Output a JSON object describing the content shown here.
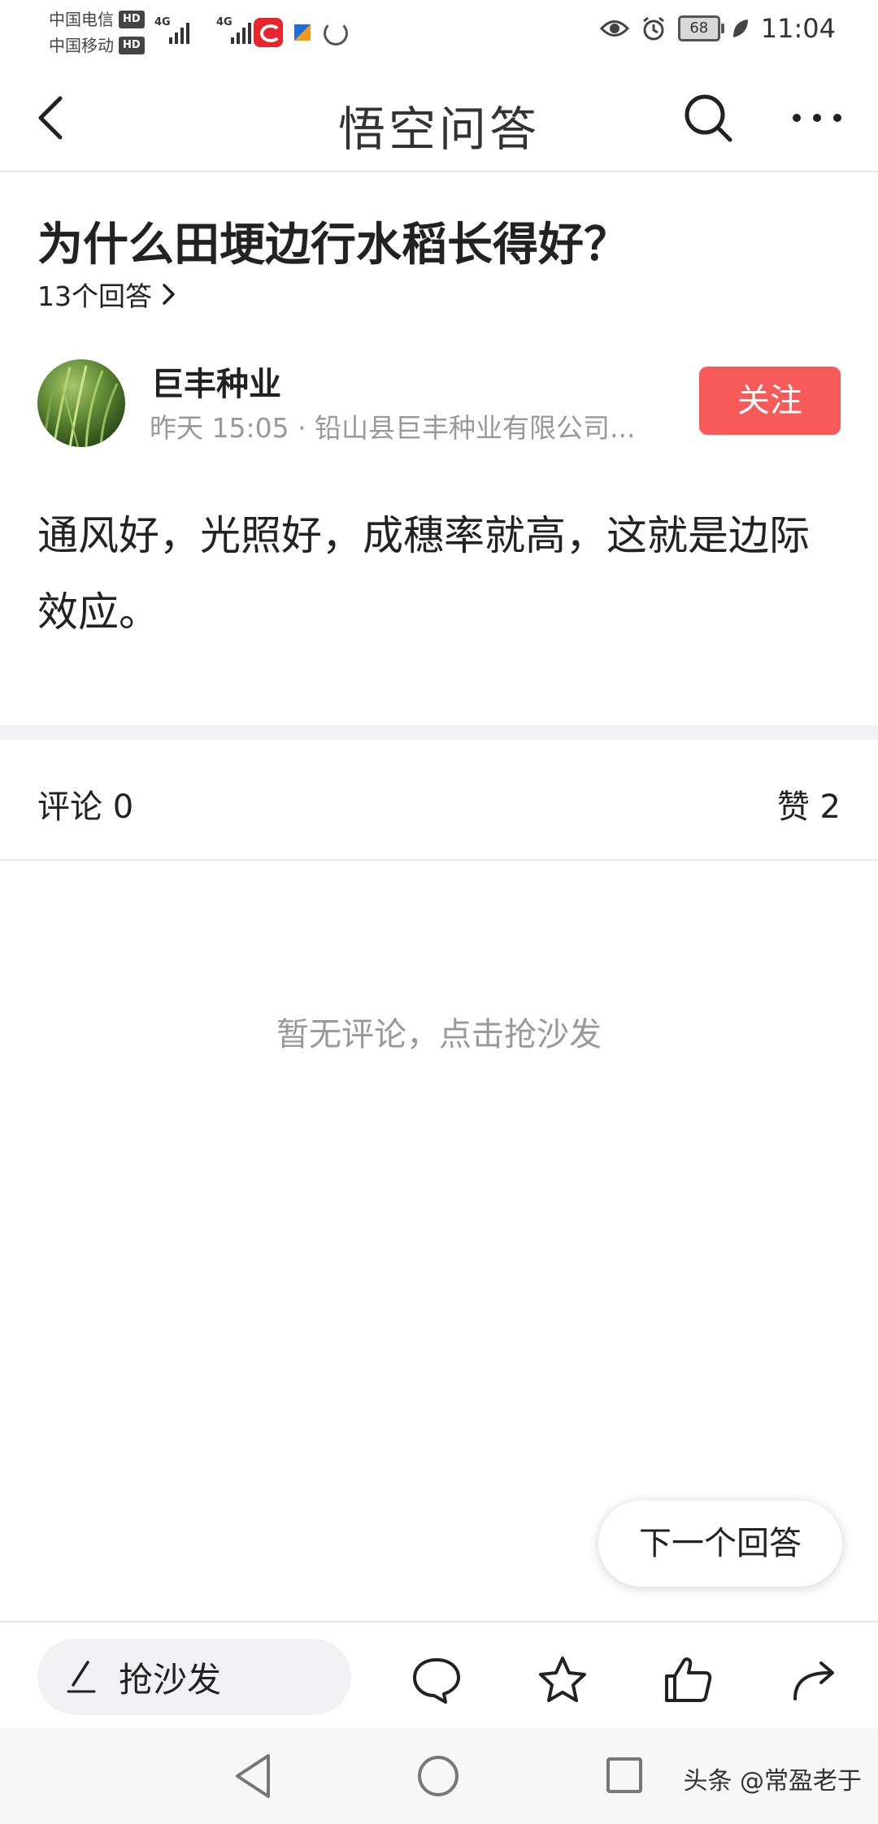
{
  "status_bar": {
    "carrier_1": "中国电信",
    "carrier_2": "中国移动",
    "hd_badge": "HD",
    "network_1": "4G",
    "network_2": "4G",
    "battery_level": "68",
    "time": "11:04"
  },
  "nav": {
    "title": "悟空问答",
    "icons": [
      "back-icon",
      "search-icon",
      "more-icon"
    ]
  },
  "question": {
    "title": "为什么田埂边行水稻长得好？",
    "answer_count": "13个回答"
  },
  "author": {
    "name": "巨丰种业",
    "meta": "昨天 15:05 · 铅山县巨丰种业有限公司...",
    "follow_label": "关注"
  },
  "answer": {
    "text": "通风好，光照好，成穗率就高，这就是边际效应。"
  },
  "stats": {
    "comments": "评论 0",
    "likes": "赞 2"
  },
  "comments": {
    "empty_text": "暂无评论，点击抢沙发"
  },
  "next_answer": {
    "label": "下一个回答"
  },
  "action_bar": {
    "comment_placeholder": "抢沙发",
    "icons": [
      "comment-icon",
      "star-icon",
      "thumbs-up-icon",
      "share-icon"
    ]
  },
  "system_nav": {
    "watermark": "头条 @常盈老于"
  },
  "colors": {
    "accent": "#f85959",
    "muted_text": "#999999",
    "divider": "#f2f2f4"
  }
}
